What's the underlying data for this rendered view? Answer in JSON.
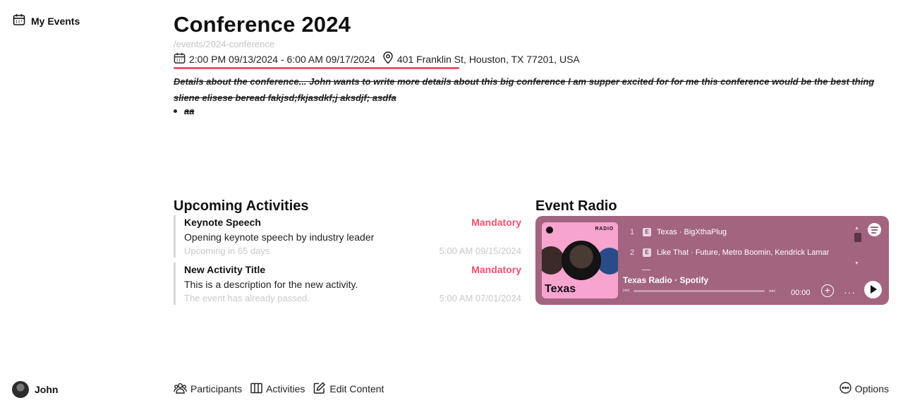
{
  "sidebar": {
    "title": "My Events",
    "user_name": "John"
  },
  "event": {
    "title": "Conference 2024",
    "slug": "/events/2024-conference",
    "time_range": "2:00 PM 09/13/2024 - 6:00 AM 09/17/2024",
    "location": "401 Franklin St, Houston, TX 77201, USA",
    "details": "Details about the conference... John wants to write more details about this big conference I am supper excited for for me this conference would be the best thing sliene elisese beread fakjsd;fkjasdkf;j aksdjf; asdfa",
    "bullet": "aa",
    "accent_color": "#f0506e"
  },
  "activities": {
    "heading": "Upcoming Activities",
    "items": [
      {
        "title": "Keynote Speech",
        "badge": "Mandatory",
        "description": "Opening keynote speech by industry leader",
        "status": "Upcoming in 65 days",
        "date": "5:00 AM 09/15/2024"
      },
      {
        "title": "New Activity Title",
        "badge": "Mandatory",
        "description": "This is a description for the new activity.",
        "status": "The event has already passed.",
        "date": "5:00 AM 07/01/2024"
      }
    ]
  },
  "radio": {
    "heading": "Event Radio",
    "cover_label": "RADIO",
    "cover_title": "Texas",
    "tracks": [
      {
        "num": "1",
        "explicit": "E",
        "title": "Texas · BigXthaPlug"
      },
      {
        "num": "2",
        "explicit": "E",
        "title": "Like That · Future, Metro Boomin, Kendrick Lamar"
      }
    ],
    "source": "Texas Radio · Spotify",
    "time": "00:00",
    "player_color": "#a3647f"
  },
  "bottom_nav": {
    "participants": "Participants",
    "activities": "Activities",
    "edit_content": "Edit Content",
    "options": "Options"
  }
}
